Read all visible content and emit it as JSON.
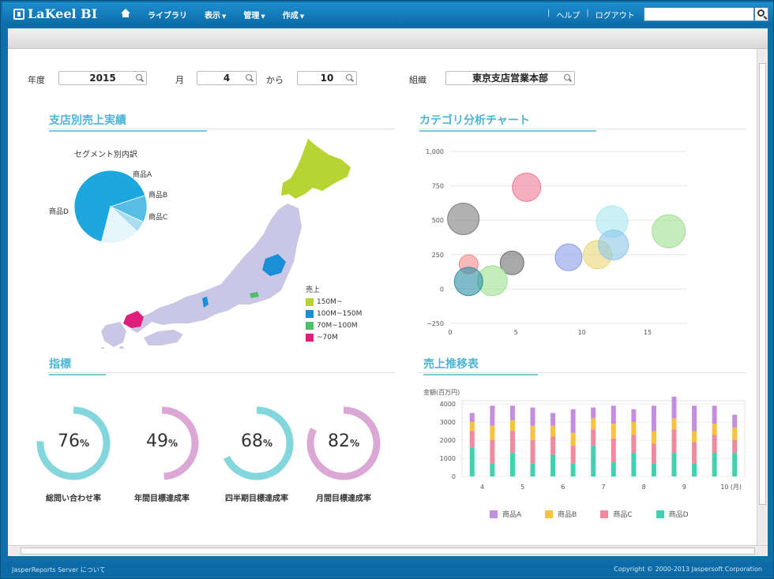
{
  "app": {
    "logo": "LaKeel BI",
    "nav": [
      {
        "label": "ライブラリ"
      },
      {
        "label": "表示"
      },
      {
        "label": "管理"
      },
      {
        "label": "作成"
      }
    ],
    "help": "ヘルプ",
    "logout": "ログアウト",
    "footer_left": "JasperReports Server について",
    "footer_right": "Copyright © 2000-2013 Jaspersoft Corporation"
  },
  "filters": {
    "year_label": "年度",
    "year_value": "2015",
    "month_label": "月",
    "month_value": "4",
    "from_label": "から",
    "to_value": "10",
    "org_label": "組織",
    "org_value": "東京支店営業本部"
  },
  "sections": {
    "branch_sales": "支店別売上実績",
    "category_chart": "カテゴリ分析チャート",
    "indicators": "指標",
    "sales_trend": "売上推移表"
  },
  "pie": {
    "title": "セグメント別内訳",
    "slices": [
      {
        "label": "商品D",
        "value": 66,
        "color": "#1da8dd"
      },
      {
        "label": "商品A",
        "value": 12,
        "color": "#56bde4"
      },
      {
        "label": "商品B",
        "value": 5,
        "color": "#a9dcf1"
      },
      {
        "label": "商品C",
        "value": 17,
        "color": "#e6f4fb"
      }
    ]
  },
  "map_legend": {
    "title": "売上",
    "items": [
      {
        "label": "150M~",
        "color": "#b8d433"
      },
      {
        "label": "100M~150M",
        "color": "#1a8fd8"
      },
      {
        "label": "70M~100M",
        "color": "#4dbf6b"
      },
      {
        "label": "~70M",
        "color": "#e01f7c"
      }
    ]
  },
  "gauges": [
    {
      "label": "総問い合わせ率",
      "value": 76,
      "color": "#84d6dd"
    },
    {
      "label": "年間目標達成率",
      "value": 49,
      "color": "#dba8d6"
    },
    {
      "label": "四半期目標達成率",
      "value": 68,
      "color": "#84d6dd"
    },
    {
      "label": "月間目標達成率",
      "value": 82,
      "color": "#dba8d6"
    }
  ],
  "percent_sign": "%",
  "chart_data": [
    {
      "type": "scatter",
      "subtype": "bubble",
      "title": "",
      "xlim": [
        0,
        18
      ],
      "ylim": [
        -250,
        1000
      ],
      "x_ticks": [
        "0",
        "5",
        "10",
        "15"
      ],
      "y_ticks": [
        "1,000",
        "750",
        "500",
        "250",
        "0",
        "−250"
      ],
      "grid": true,
      "points": [
        {
          "x": 1.0,
          "y": 510,
          "r": 20,
          "color": "#7d7d7d"
        },
        {
          "x": 5.8,
          "y": 740,
          "r": 18,
          "color": "#f07a92"
        },
        {
          "x": 1.4,
          "y": 180,
          "r": 12,
          "color": "#f58a8a"
        },
        {
          "x": 4.7,
          "y": 190,
          "r": 15,
          "color": "#6e6e6e"
        },
        {
          "x": 3.2,
          "y": 60,
          "r": 19,
          "color": "#9ee08e"
        },
        {
          "x": 1.4,
          "y": 55,
          "r": 18,
          "color": "#2a8fa6"
        },
        {
          "x": 9.0,
          "y": 230,
          "r": 17,
          "color": "#8a9de6"
        },
        {
          "x": 11.2,
          "y": 250,
          "r": 18,
          "color": "#e8d676"
        },
        {
          "x": 12.3,
          "y": 490,
          "r": 20,
          "color": "#a7e8ec"
        },
        {
          "x": 12.4,
          "y": 320,
          "r": 19,
          "color": "#8ec6ea"
        },
        {
          "x": 16.6,
          "y": 420,
          "r": 21,
          "color": "#9ee08e"
        }
      ]
    },
    {
      "type": "bar",
      "stacked": true,
      "title": "",
      "ylabel": "金額(百万円)",
      "xlabel_unit": "(月)",
      "ylim": [
        0,
        4000
      ],
      "y_ticks": [
        "4000",
        "3000",
        "2000",
        "1000",
        "0"
      ],
      "x_ticks": [
        "4",
        "5",
        "6",
        "7",
        "8",
        "9",
        "10"
      ],
      "categories": [
        "4",
        "",
        "5",
        "",
        "6",
        "",
        "7",
        "",
        "8",
        "",
        "9",
        "",
        "10",
        ""
      ],
      "series": [
        {
          "name": "商品D",
          "color": "#3fd1b0",
          "values": [
            1600,
            700,
            1300,
            700,
            1200,
            700,
            1700,
            800,
            1300,
            700,
            1300,
            700,
            1300,
            1300
          ]
        },
        {
          "name": "商品C",
          "color": "#f28a9f",
          "values": [
            900,
            1300,
            1200,
            1300,
            1000,
            1000,
            900,
            1300,
            1000,
            1100,
            1300,
            1200,
            1000,
            700
          ]
        },
        {
          "name": "商品B",
          "color": "#f7c23d",
          "values": [
            500,
            800,
            600,
            800,
            600,
            700,
            600,
            800,
            700,
            700,
            600,
            600,
            600,
            700
          ]
        },
        {
          "name": "商品A",
          "color": "#c48de0",
          "values": [
            500,
            1100,
            800,
            1000,
            700,
            1300,
            600,
            1000,
            700,
            1400,
            1200,
            1400,
            1000,
            700
          ]
        }
      ],
      "legend_position": "bottom"
    }
  ]
}
